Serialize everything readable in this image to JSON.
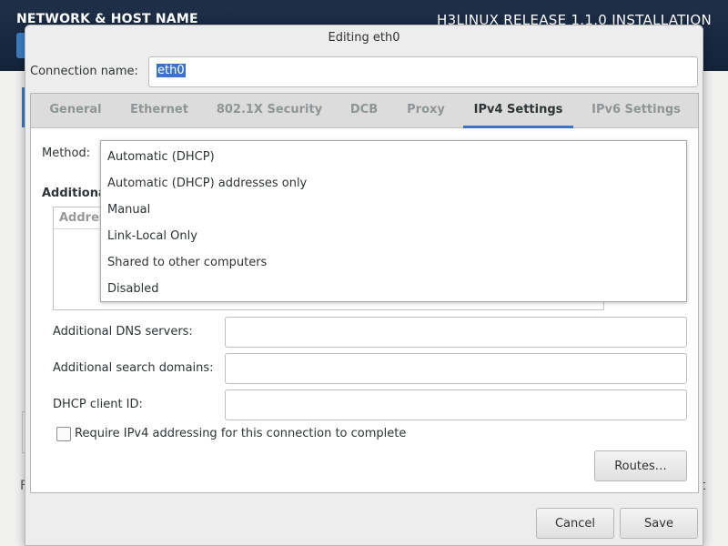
{
  "background": {
    "left_title": "NETWORK & HOST NAME",
    "right_title": "H3LINUX RELEASE 1.1.0 INSTALLATION",
    "left_edge_char": "F",
    "right_edge_char": "t"
  },
  "dialog": {
    "title": "Editing eth0",
    "connection_name_label": "Connection name:",
    "connection_name_value": "eth0"
  },
  "tabs": [
    {
      "label": "General",
      "active": false
    },
    {
      "label": "Ethernet",
      "active": false
    },
    {
      "label": "802.1X Security",
      "active": false
    },
    {
      "label": "DCB",
      "active": false
    },
    {
      "label": "Proxy",
      "active": false
    },
    {
      "label": "IPv4 Settings",
      "active": true
    },
    {
      "label": "IPv6 Settings",
      "active": false
    }
  ],
  "ipv4": {
    "method_label": "Method:",
    "method_options": [
      "Automatic (DHCP)",
      "Automatic (DHCP) addresses only",
      "Manual",
      "Link-Local Only",
      "Shared to other computers",
      "Disabled"
    ],
    "addresses_heading_partial": "Additiona",
    "addresses_column_partial": "Addres",
    "dns_label": "Additional DNS servers:",
    "dns_value": "",
    "search_domains_label": "Additional search domains:",
    "search_domains_value": "",
    "dhcp_client_id_label": "DHCP client ID:",
    "dhcp_client_id_value": "",
    "require_ipv4_label": "Require IPv4 addressing for this connection to complete",
    "require_ipv4_checked": false,
    "routes_button": "Routes…"
  },
  "footer": {
    "cancel_label": "Cancel",
    "save_label": "Save"
  },
  "colors": {
    "header_bg": "#13233a",
    "accent": "#3b73c7",
    "dialog_bg": "#ededed"
  }
}
